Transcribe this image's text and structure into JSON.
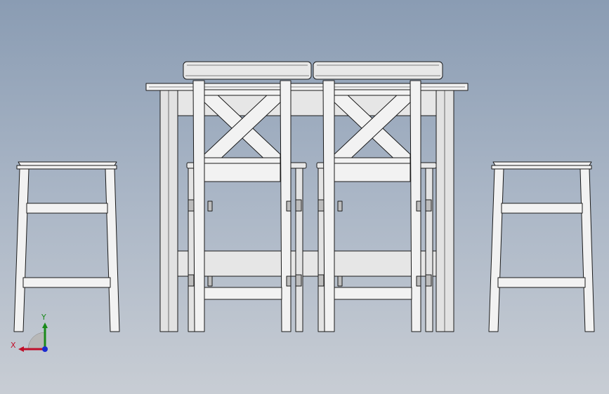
{
  "viewport": {
    "background_top": "#8a9cb3",
    "background_bottom": "#c8cdd4"
  },
  "model": {
    "face_color": "#f2f2f2",
    "shade_color": "#d6d6d6",
    "edge_color": "#1a1a1a"
  },
  "triad": {
    "x_label": "X",
    "y_label": "Y",
    "x_color": "#c0102a",
    "y_color": "#1a8a1a",
    "z_color": "#1a2ad0"
  }
}
